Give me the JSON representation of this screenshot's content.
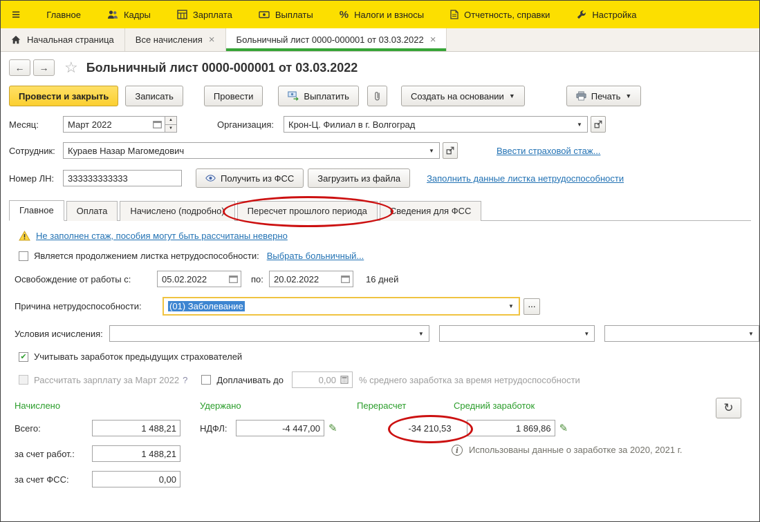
{
  "colors": {
    "menu_yellow": "#fcdf00",
    "active_tab_green": "#37a537",
    "link_blue": "#2272b4",
    "section_green": "#2a9d2a",
    "primary_button_yellow": "#fbcf30",
    "annotation_red": "#cc1111"
  },
  "menu": {
    "items": [
      {
        "label": "Главное",
        "icon": "hamburger"
      },
      {
        "label": "Кадры",
        "icon": "people-icon"
      },
      {
        "label": "Зарплата",
        "icon": "table-icon"
      },
      {
        "label": "Выплаты",
        "icon": "banknote-icon"
      },
      {
        "label": "Налоги и взносы",
        "icon": "percent-icon"
      },
      {
        "label": "Отчетность, справки",
        "icon": "report-icon"
      },
      {
        "label": "Настройка",
        "icon": "wrench-icon"
      }
    ]
  },
  "window_tabs": {
    "home": "Начальная страница",
    "items": [
      {
        "label": "Все начисления"
      },
      {
        "label": "Больничный лист 0000-000001 от 03.03.2022"
      }
    ]
  },
  "header": {
    "title": "Больничный лист 0000-000001 от 03.03.2022"
  },
  "toolbar": {
    "post_and_close": "Провести и закрыть",
    "write": "Записать",
    "post": "Провести",
    "pay": "Выплатить",
    "create_on_basis": "Создать на основании",
    "print": "Печать"
  },
  "form": {
    "month": {
      "label": "Месяц:",
      "value": "Март 2022"
    },
    "organization": {
      "label": "Организация:",
      "value": "Крон-Ц. Филиал в г. Волгоград"
    },
    "employee": {
      "label": "Сотрудник:",
      "value": "Кураев Назар Магомедович",
      "link": "Ввести страховой стаж..."
    },
    "sick_number": {
      "label": "Номер ЛН:",
      "value": "333333333333",
      "fss_button": "Получить из ФСС",
      "file_button": "Загрузить из файла",
      "fill_link": "Заполнить данные листка нетрудоспособности"
    }
  },
  "page_tabs": [
    "Главное",
    "Оплата",
    "Начислено (подробно)",
    "Пересчет прошлого периода",
    "Сведения для ФСС"
  ],
  "main_tab": {
    "warning_link": "Не заполнен стаж, пособия могут быть рассчитаны неверно",
    "continuation": {
      "label": "Является продолжением листка нетрудоспособности:",
      "link": "Выбрать больничный..."
    },
    "leave_period": {
      "label": "Освобождение от работы с:",
      "from": "05.02.2022",
      "to_label": "по:",
      "to": "20.02.2022",
      "days": "16 дней"
    },
    "reason": {
      "label": "Причина нетрудоспособности:",
      "value": "(01) Заболевание"
    },
    "conditions_label": "Условия исчисления:",
    "prev_earnings_checkbox": "Учитывать заработок предыдущих страхователей",
    "calc_salary": {
      "label": "Рассчитать зарплату за Март 2022",
      "help": "?"
    },
    "pay_up_to": {
      "label": "Доплачивать до",
      "value": "0,00",
      "suffix": "% среднего заработка за время нетрудоспособности"
    }
  },
  "totals": {
    "accrued_header": "Начислено",
    "withheld_header": "Удержано",
    "recalc_header": "Перерасчет",
    "average_header": "Средний заработок",
    "total": {
      "label": "Всего:",
      "value": "1 488,21"
    },
    "ndfl": {
      "label": "НДФЛ:",
      "value": "-4 447,00"
    },
    "recalc_value": "-34 210,53",
    "average_value": "1 869,86",
    "employer": {
      "label": "за счет работ.:",
      "value": "1 488,21"
    },
    "fss": {
      "label": "за счет ФСС:",
      "value": "0,00"
    },
    "info_note": "Использованы данные о заработке за 2020,  2021 г."
  },
  "annotations": [
    {
      "target": "tab-recalc-period",
      "pad_x": 22,
      "pad_y": 8
    },
    {
      "target": "recalc-value",
      "pad_x": 30,
      "pad_y": 13
    }
  ]
}
